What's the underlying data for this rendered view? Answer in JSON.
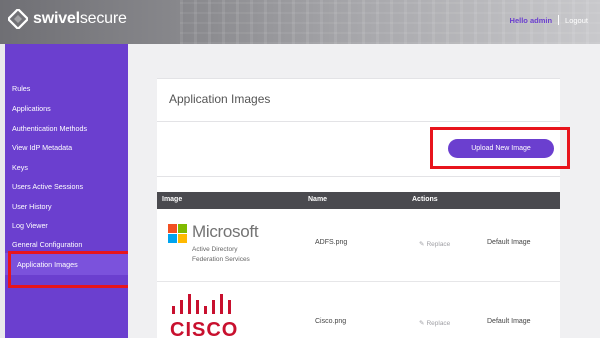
{
  "header": {
    "logo_bold": "swivel",
    "logo_light": "secure",
    "hello": "Hello admin",
    "logout": "Logout"
  },
  "sidebar": {
    "items": [
      {
        "label": "Rules"
      },
      {
        "label": "Applications"
      },
      {
        "label": "Authentication Methods"
      },
      {
        "label": "View IdP Metadata"
      },
      {
        "label": "Keys"
      },
      {
        "label": "Users Active Sessions"
      },
      {
        "label": "User History"
      },
      {
        "label": "Log Viewer"
      },
      {
        "label": "General Configuration"
      },
      {
        "label": "Application Images"
      }
    ],
    "active_index": 9
  },
  "main": {
    "title": "Application Images",
    "upload_label": "Upload New Image",
    "table": {
      "headers": [
        "Image",
        "Name",
        "Actions",
        ""
      ],
      "rows": [
        {
          "logo_word": "Microsoft",
          "logo_sub1": "Active Directory",
          "logo_sub2": "Federation Services",
          "name": "ADFS.png",
          "action": "Replace",
          "default": "Default Image"
        },
        {
          "logo_word": "CISCO",
          "name": "Cisco.png",
          "action": "Replace",
          "default": "Default Image"
        }
      ]
    }
  },
  "colors": {
    "accent": "#6b3fcf",
    "highlight": "#e8141c",
    "microsoft": [
      "#f25022",
      "#7fba00",
      "#00a4ef",
      "#ffb900"
    ],
    "cisco": "#c8102e"
  }
}
